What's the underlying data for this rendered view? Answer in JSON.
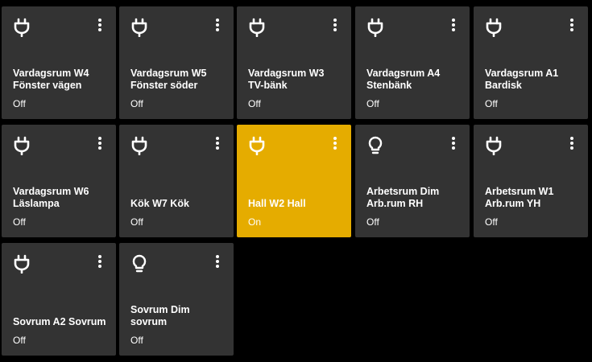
{
  "colors": {
    "background": "#000000",
    "tile_off": "#333333",
    "tile_on": "#e5ac00",
    "text": "#ffffff"
  },
  "tiles": [
    {
      "icon": "power-plug-icon",
      "name": "Vardagsrum W4\nFönster vägen",
      "state": "Off",
      "on": false
    },
    {
      "icon": "power-plug-icon",
      "name": "Vardagsrum W5\nFönster söder",
      "state": "Off",
      "on": false
    },
    {
      "icon": "power-plug-icon",
      "name": "Vardagsrum W3\nTV-bänk",
      "state": "Off",
      "on": false
    },
    {
      "icon": "power-plug-icon",
      "name": "Vardagsrum A4\nStenbänk",
      "state": "Off",
      "on": false
    },
    {
      "icon": "power-plug-icon",
      "name": "Vardagsrum A1\nBardisk",
      "state": "Off",
      "on": false
    },
    {
      "icon": "power-plug-icon",
      "name": "Vardagsrum W6\nLäslampa",
      "state": "Off",
      "on": false
    },
    {
      "icon": "power-plug-icon",
      "name": "Kök W7 Kök",
      "state": "Off",
      "on": false
    },
    {
      "icon": "power-plug-icon",
      "name": "Hall W2 Hall",
      "state": "On",
      "on": true
    },
    {
      "icon": "lightbulb-icon",
      "name": "Arbetsrum Dim\nArb.rum RH",
      "state": "Off",
      "on": false
    },
    {
      "icon": "power-plug-icon",
      "name": "Arbetsrum W1\nArb.rum YH",
      "state": "Off",
      "on": false
    },
    {
      "icon": "power-plug-icon",
      "name": "Sovrum A2 Sovrum",
      "state": "Off",
      "on": false
    },
    {
      "icon": "lightbulb-icon",
      "name": "Sovrum Dim\nsovrum",
      "state": "Off",
      "on": false
    }
  ]
}
